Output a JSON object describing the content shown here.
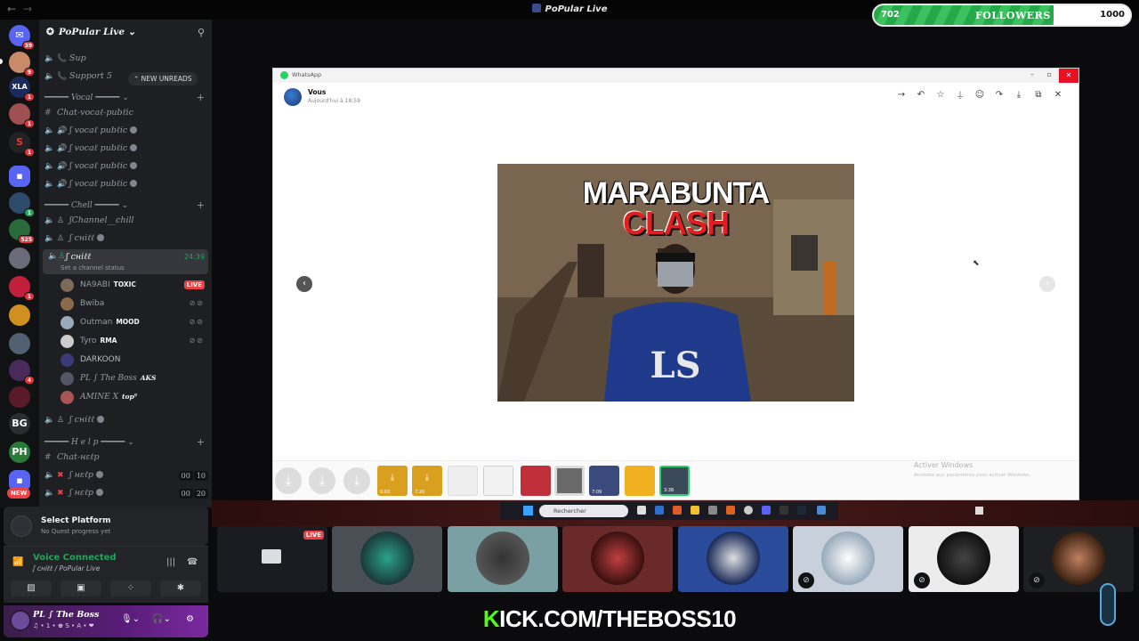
{
  "window": {
    "title": "PoPular Live",
    "back": "←",
    "forward": "→"
  },
  "followers": {
    "label": "FOLLOWERS",
    "current": "702",
    "goal": "1000",
    "progress": 0.702
  },
  "server_rail": {
    "badges": [
      "39",
      "9",
      "1",
      "1",
      "1",
      "1",
      "525",
      "1",
      "4",
      "8",
      "2"
    ],
    "bg_label": "BG",
    "new_label": "NEW"
  },
  "sidebar": {
    "server_name": "PoPular Live",
    "new_unreads": "NEW UNREADS",
    "channels_top": [
      {
        "name": "Support 5"
      }
    ],
    "cat_vocal": "Vocal",
    "vocal_text": "Chat-vocaℓ-pubℓic",
    "vocal_rooms": [
      "ʃ vocaℓ pubℓic",
      "ʃ vocaℓ pubℓic",
      "ʃ vocaℓ pubℓic",
      "ʃ vocaℓ pubℓic"
    ],
    "cat_chill": "Chell",
    "chill_text": "ʃChannel__chill",
    "chill_room": "ʃ cнiℓℓ",
    "active_room": "ʃ cнiℓℓ",
    "active_status": "Set a channel status",
    "active_timer": "24:39",
    "users": [
      {
        "name": "NA9ABI",
        "tag": "TOXIC",
        "live": "LIVE"
      },
      {
        "name": "Bwiba",
        "tag": ""
      },
      {
        "name": "Outman",
        "tag": "MOOD"
      },
      {
        "name": "Tyro",
        "tag": "RMA"
      },
      {
        "name": "DARKOON",
        "tag": ""
      },
      {
        "name": "PL ∫ The Boss",
        "tag": "AKS"
      },
      {
        "name": "AMINE X",
        "tag": "top⁹"
      }
    ],
    "chill_room2": "ʃ cнiℓℓ",
    "cat_help": "H e l p",
    "help_text": "Chat-нεℓp",
    "help_rooms": [
      {
        "name": "ʃ нεℓp",
        "c1": "00",
        "c2": "10"
      },
      {
        "name": "ʃ нεℓp",
        "c1": "00",
        "c2": "20"
      }
    ]
  },
  "quest": {
    "title": "Select Platform",
    "subtitle": "No Quest progress yet"
  },
  "voice": {
    "status": "Voice Connected",
    "channel": "ʃ cнiℓℓ / PoPular Live"
  },
  "user": {
    "name": "PL ∫ The Boss",
    "status": "♫ • 1 • ♚ S • A • ❤"
  },
  "viewer": {
    "app": "WhatsApp",
    "sender": "Vous",
    "time": "Aujourd'hui à 18:59",
    "image_title1": "MARABUNTA",
    "image_title2": "CLASH",
    "activate1": "Activer Windows",
    "activate2": "Accédez aux paramètres pour activer Windows.",
    "thumb_labels": [
      "0:03",
      "7:20",
      "7:09",
      "3:38"
    ]
  },
  "taskbar": {
    "search_placeholder": "Rechercher"
  },
  "stage": {
    "live": "LIVE"
  },
  "banner": {
    "k": "K",
    "rest": "ICK.COM/THEBOSS10"
  },
  "colors": {
    "accent_green": "#23a55a",
    "live_red": "#ed4245",
    "kick_green": "#53fc18",
    "followers_green": "#3cc15f"
  }
}
